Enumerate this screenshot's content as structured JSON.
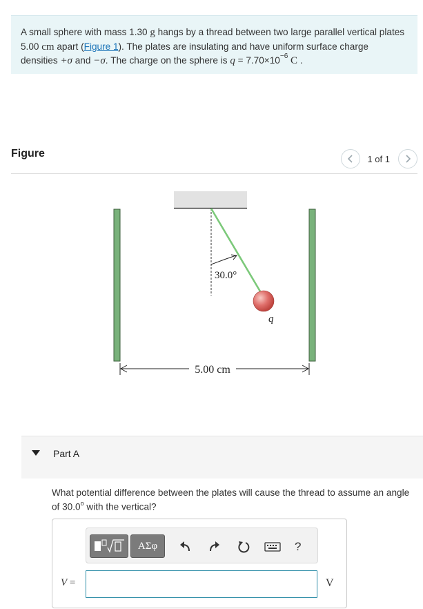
{
  "problem": {
    "seg1": "A small sphere with mass 1.30 ",
    "mass_unit": "g",
    "seg2": " hangs by a thread between two large parallel vertical plates 5.00 ",
    "dist_unit": "cm",
    "seg3": " apart (",
    "figure_link": "Figure 1",
    "seg4": "). The plates are insulating and have uniform surface charge densities ",
    "plus_sigma": "+σ",
    "seg5": " and ",
    "minus_sigma": "−σ",
    "seg6": ". The charge on the sphere is ",
    "q_symbol": "q",
    "seg7": " = 7.70×10",
    "exponent": "−6",
    "seg8": " ",
    "charge_unit": "C",
    "seg9": " ."
  },
  "figure": {
    "title": "Figure",
    "pager_text": "1 of 1",
    "angle_label": "30.0°",
    "charge_label": "q",
    "distance_label": "5.00 cm",
    "colors": {
      "plate": "#79b27b",
      "sphere": "#e0706c",
      "thread": "#7cc97a",
      "ceiling": "#e2e2e2"
    }
  },
  "part_a": {
    "label": "Part A",
    "question_part1": "What potential difference between the plates will cause the thread to assume an angle of 30.0",
    "question_degree": "o",
    "question_part2": " with the vertical?",
    "symbols_label": "ΑΣφ",
    "help_label": "?",
    "variable": "V",
    "equals": " =",
    "input_value": "",
    "unit": "V",
    "icons": [
      "templates-icon",
      "undo-icon",
      "redo-icon",
      "reset-icon",
      "keyboard-icon",
      "help-icon"
    ]
  }
}
